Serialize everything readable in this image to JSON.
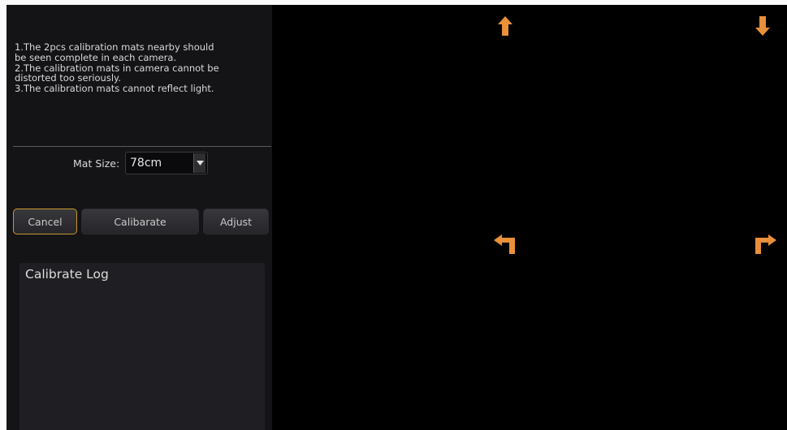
{
  "instructions": {
    "line1": "1.The 2pcs calibration mats nearby should",
    "line2": "be seen complete in each camera.",
    "line3": "2.The calibration mats in camera cannot be",
    "line4": "distorted too seriously.",
    "line5": "3.The calibration mats cannot reflect light."
  },
  "mat_size": {
    "label": "Mat Size:",
    "value": "78cm"
  },
  "buttons": {
    "cancel": "Cancel",
    "calibrate": "Calibarate",
    "adjust": "Adjust"
  },
  "log": {
    "title": "Calibrate Log"
  },
  "colors": {
    "accent_arrow": "#e8903a",
    "cancel_border": "#c9982e"
  },
  "icons": [
    "up-arrow-icon",
    "down-arrow-icon",
    "turn-left-arrow-icon",
    "turn-right-arrow-icon",
    "dropdown-arrow-icon"
  ]
}
